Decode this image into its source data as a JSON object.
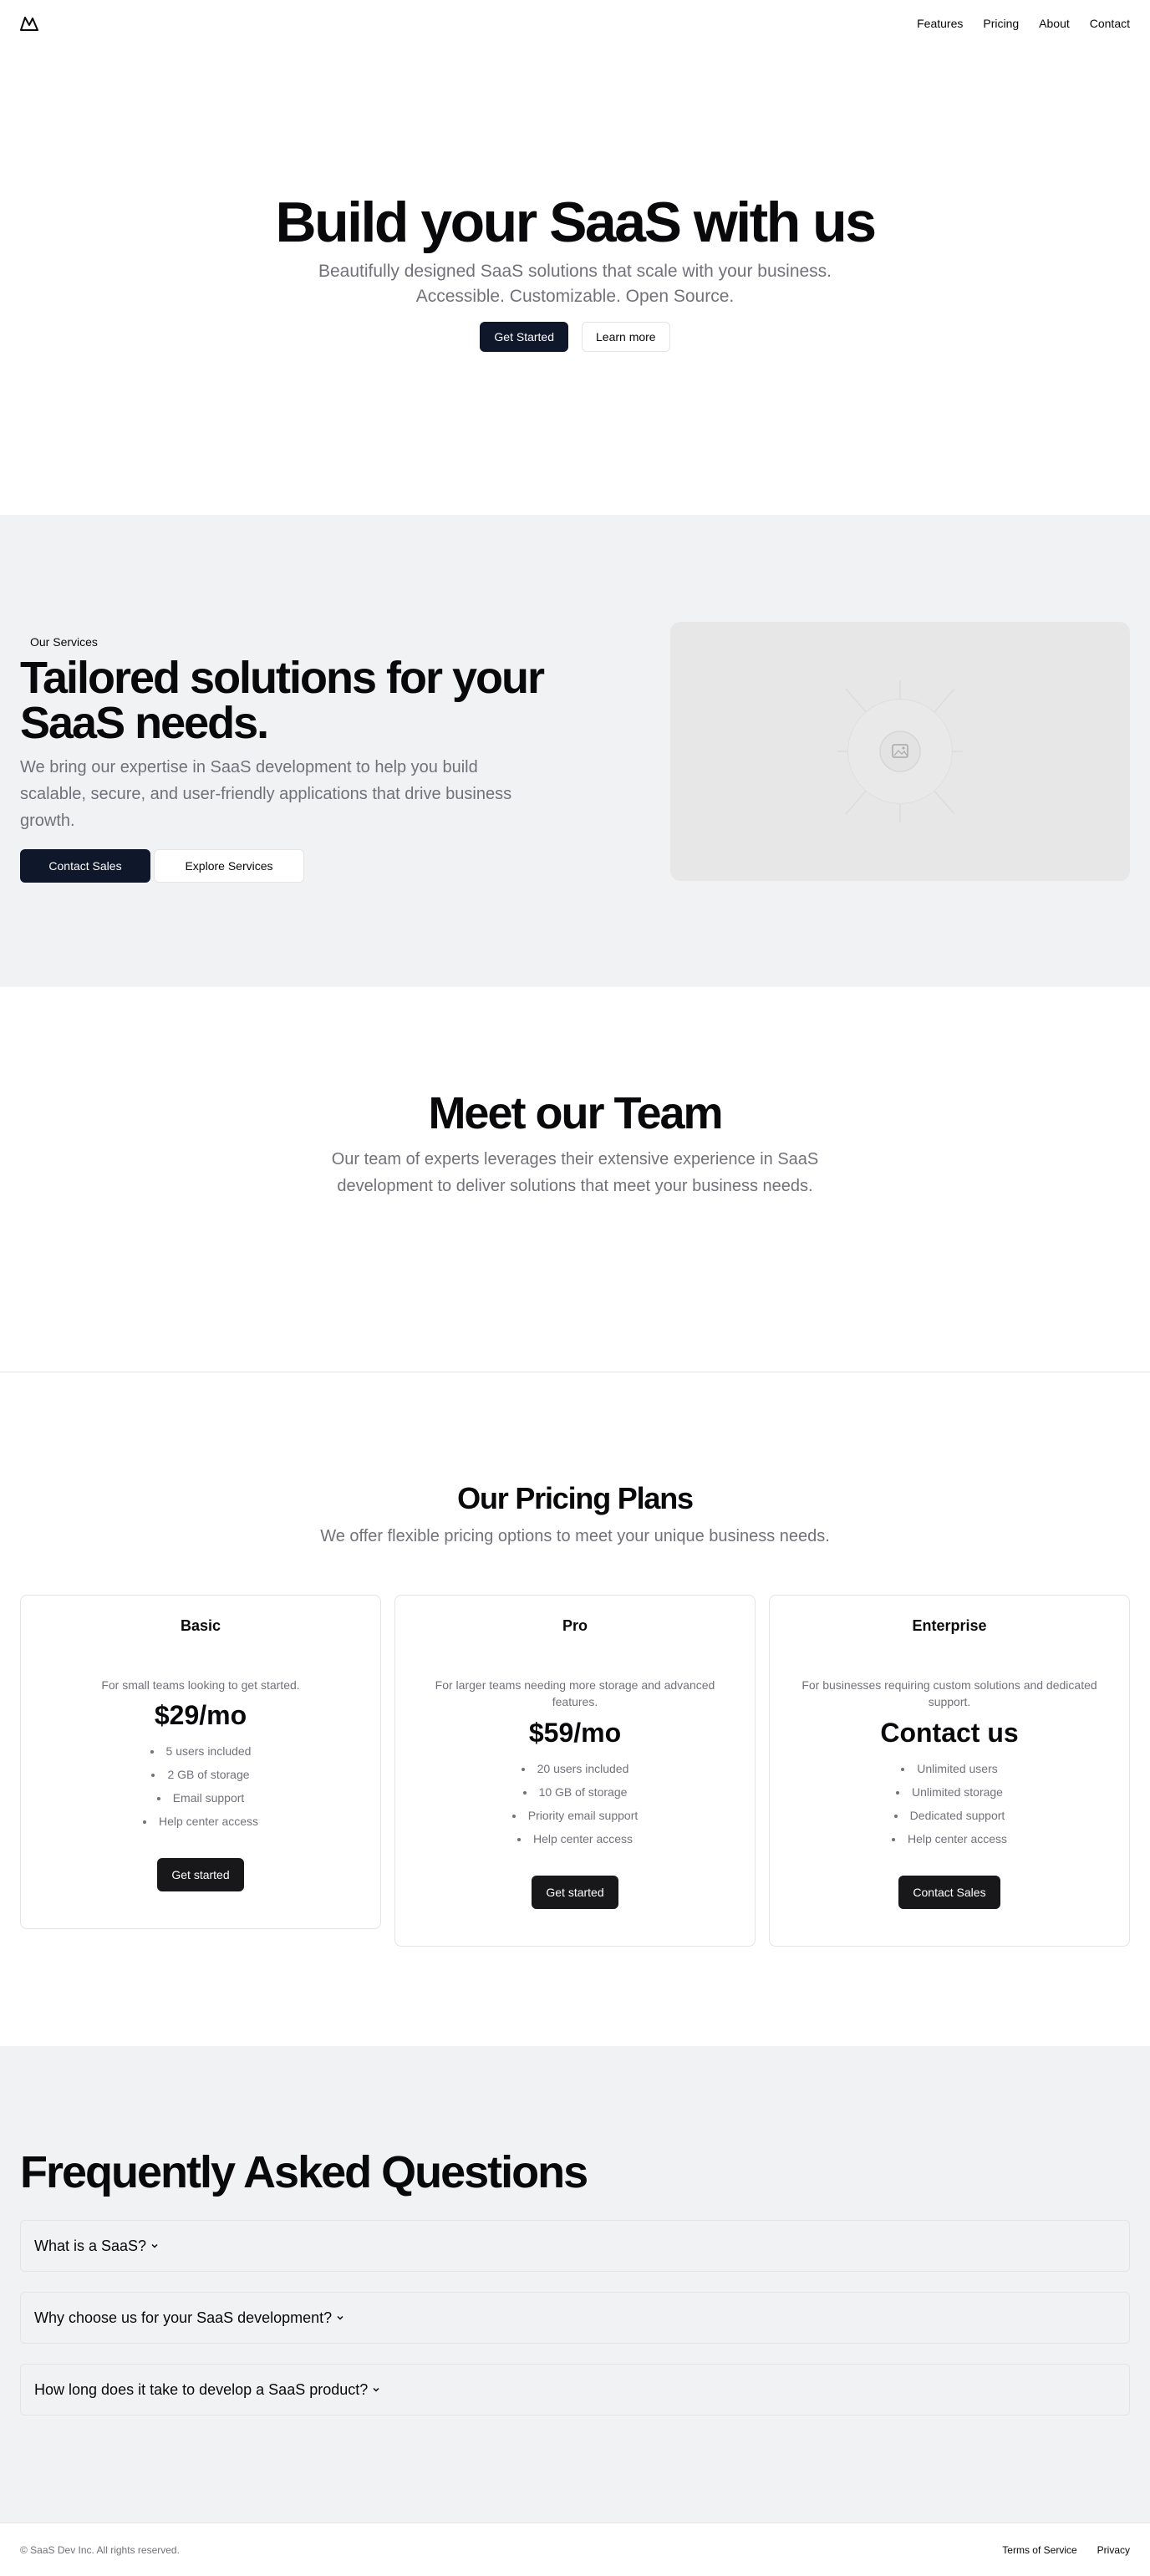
{
  "header": {
    "logo_icon": "mountain-icon",
    "nav": [
      "Features",
      "Pricing",
      "About",
      "Contact"
    ]
  },
  "hero": {
    "title": "Build your SaaS with us",
    "subtitle": "Beautifully designed SaaS solutions that scale with your business. Accessible. Customizable. Open Source.",
    "primary_button": "Get Started",
    "secondary_button": "Learn more"
  },
  "services": {
    "badge": "Our Services",
    "title": "Tailored solutions for your SaaS needs.",
    "description": "We bring our expertise in SaaS development to help you build scalable, secure, and user-friendly applications that drive business growth.",
    "primary_button": "Contact Sales",
    "secondary_button": "Explore Services",
    "image_icon": "image-placeholder-icon"
  },
  "team": {
    "title": "Meet our Team",
    "description": "Our team of experts leverages their extensive experience in SaaS development to deliver solutions that meet your business needs."
  },
  "pricing": {
    "title": "Our Pricing Plans",
    "subtitle": "We offer flexible pricing options to meet your unique business needs.",
    "plans": [
      {
        "name": "Basic",
        "description": "For small teams looking to get started.",
        "price": "$29/mo",
        "features": [
          "5 users included",
          "2 GB of storage",
          "Email support",
          "Help center access"
        ],
        "button": "Get started"
      },
      {
        "name": "Pro",
        "description": "For larger teams needing more storage and advanced features.",
        "price": "$59/mo",
        "features": [
          "20 users included",
          "10 GB of storage",
          "Priority email support",
          "Help center access"
        ],
        "button": "Get started"
      },
      {
        "name": "Enterprise",
        "description": "For businesses requiring custom solutions and dedicated support.",
        "price": "Contact us",
        "features": [
          "Unlimited users",
          "Unlimited storage",
          "Dedicated support",
          "Help center access"
        ],
        "button": "Contact Sales"
      }
    ]
  },
  "faq": {
    "title": "Frequently Asked Questions",
    "items": [
      "What is a SaaS?",
      "Why choose us for your SaaS development?",
      "How long does it take to develop a SaaS product?"
    ]
  },
  "footer": {
    "copyright": "© SaaS Dev Inc. All rights reserved.",
    "links": [
      "Terms of Service",
      "Privacy"
    ]
  },
  "colors": {
    "primary_button": "#0f172a",
    "section_gray": "#f1f2f4",
    "muted_text": "#71717a"
  }
}
